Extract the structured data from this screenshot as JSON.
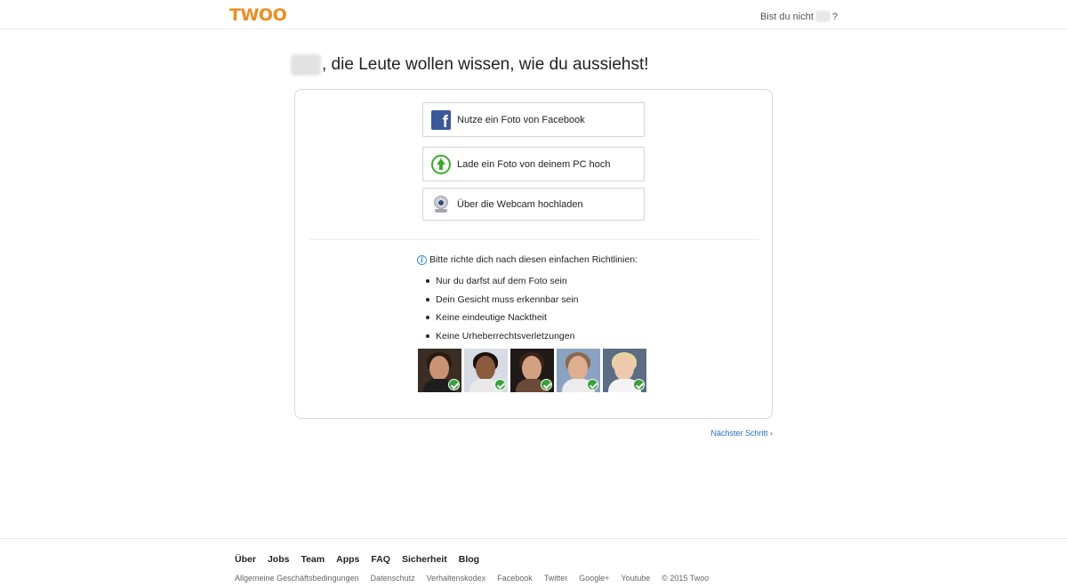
{
  "header": {
    "logo_text": "TWOO",
    "not_you_prefix": "Bist du nicht",
    "not_you_suffix": "?"
  },
  "main": {
    "headline": ", die Leute wollen wissen, wie du aussiehst!",
    "options": {
      "facebook": "Nutze ein Foto von Facebook",
      "upload": "Lade ein Foto von deinem PC hoch",
      "webcam": "Über die Webcam hochladen"
    },
    "guidelines": {
      "title": "Bitte richte dich nach diesen einfachen Richtlinien:",
      "items": [
        "Nur du darfst auf dem Foto sein",
        "Dein Gesicht muss erkennbar sein",
        "Keine eindeutige Nacktheit",
        "Keine Urheberrechtsverletzungen"
      ]
    },
    "next_link": "Nächster Schritt ›"
  },
  "footer": {
    "main_links": [
      "Über",
      "Jobs",
      "Team",
      "Apps",
      "FAQ",
      "Sicherheit",
      "Blog"
    ],
    "sub_links": [
      "Allgemeine Geschäftsbedingungen",
      "Datenschutz",
      "Verhaltenskodex",
      "Facebook",
      "Twitter",
      "Google+",
      "Youtube"
    ],
    "copyright": "© 2015 Twoo"
  },
  "colors": {
    "brand": "#f28b1c",
    "link": "#1f6fc4",
    "check": "#35a33a",
    "facebook": "#3b5998"
  }
}
